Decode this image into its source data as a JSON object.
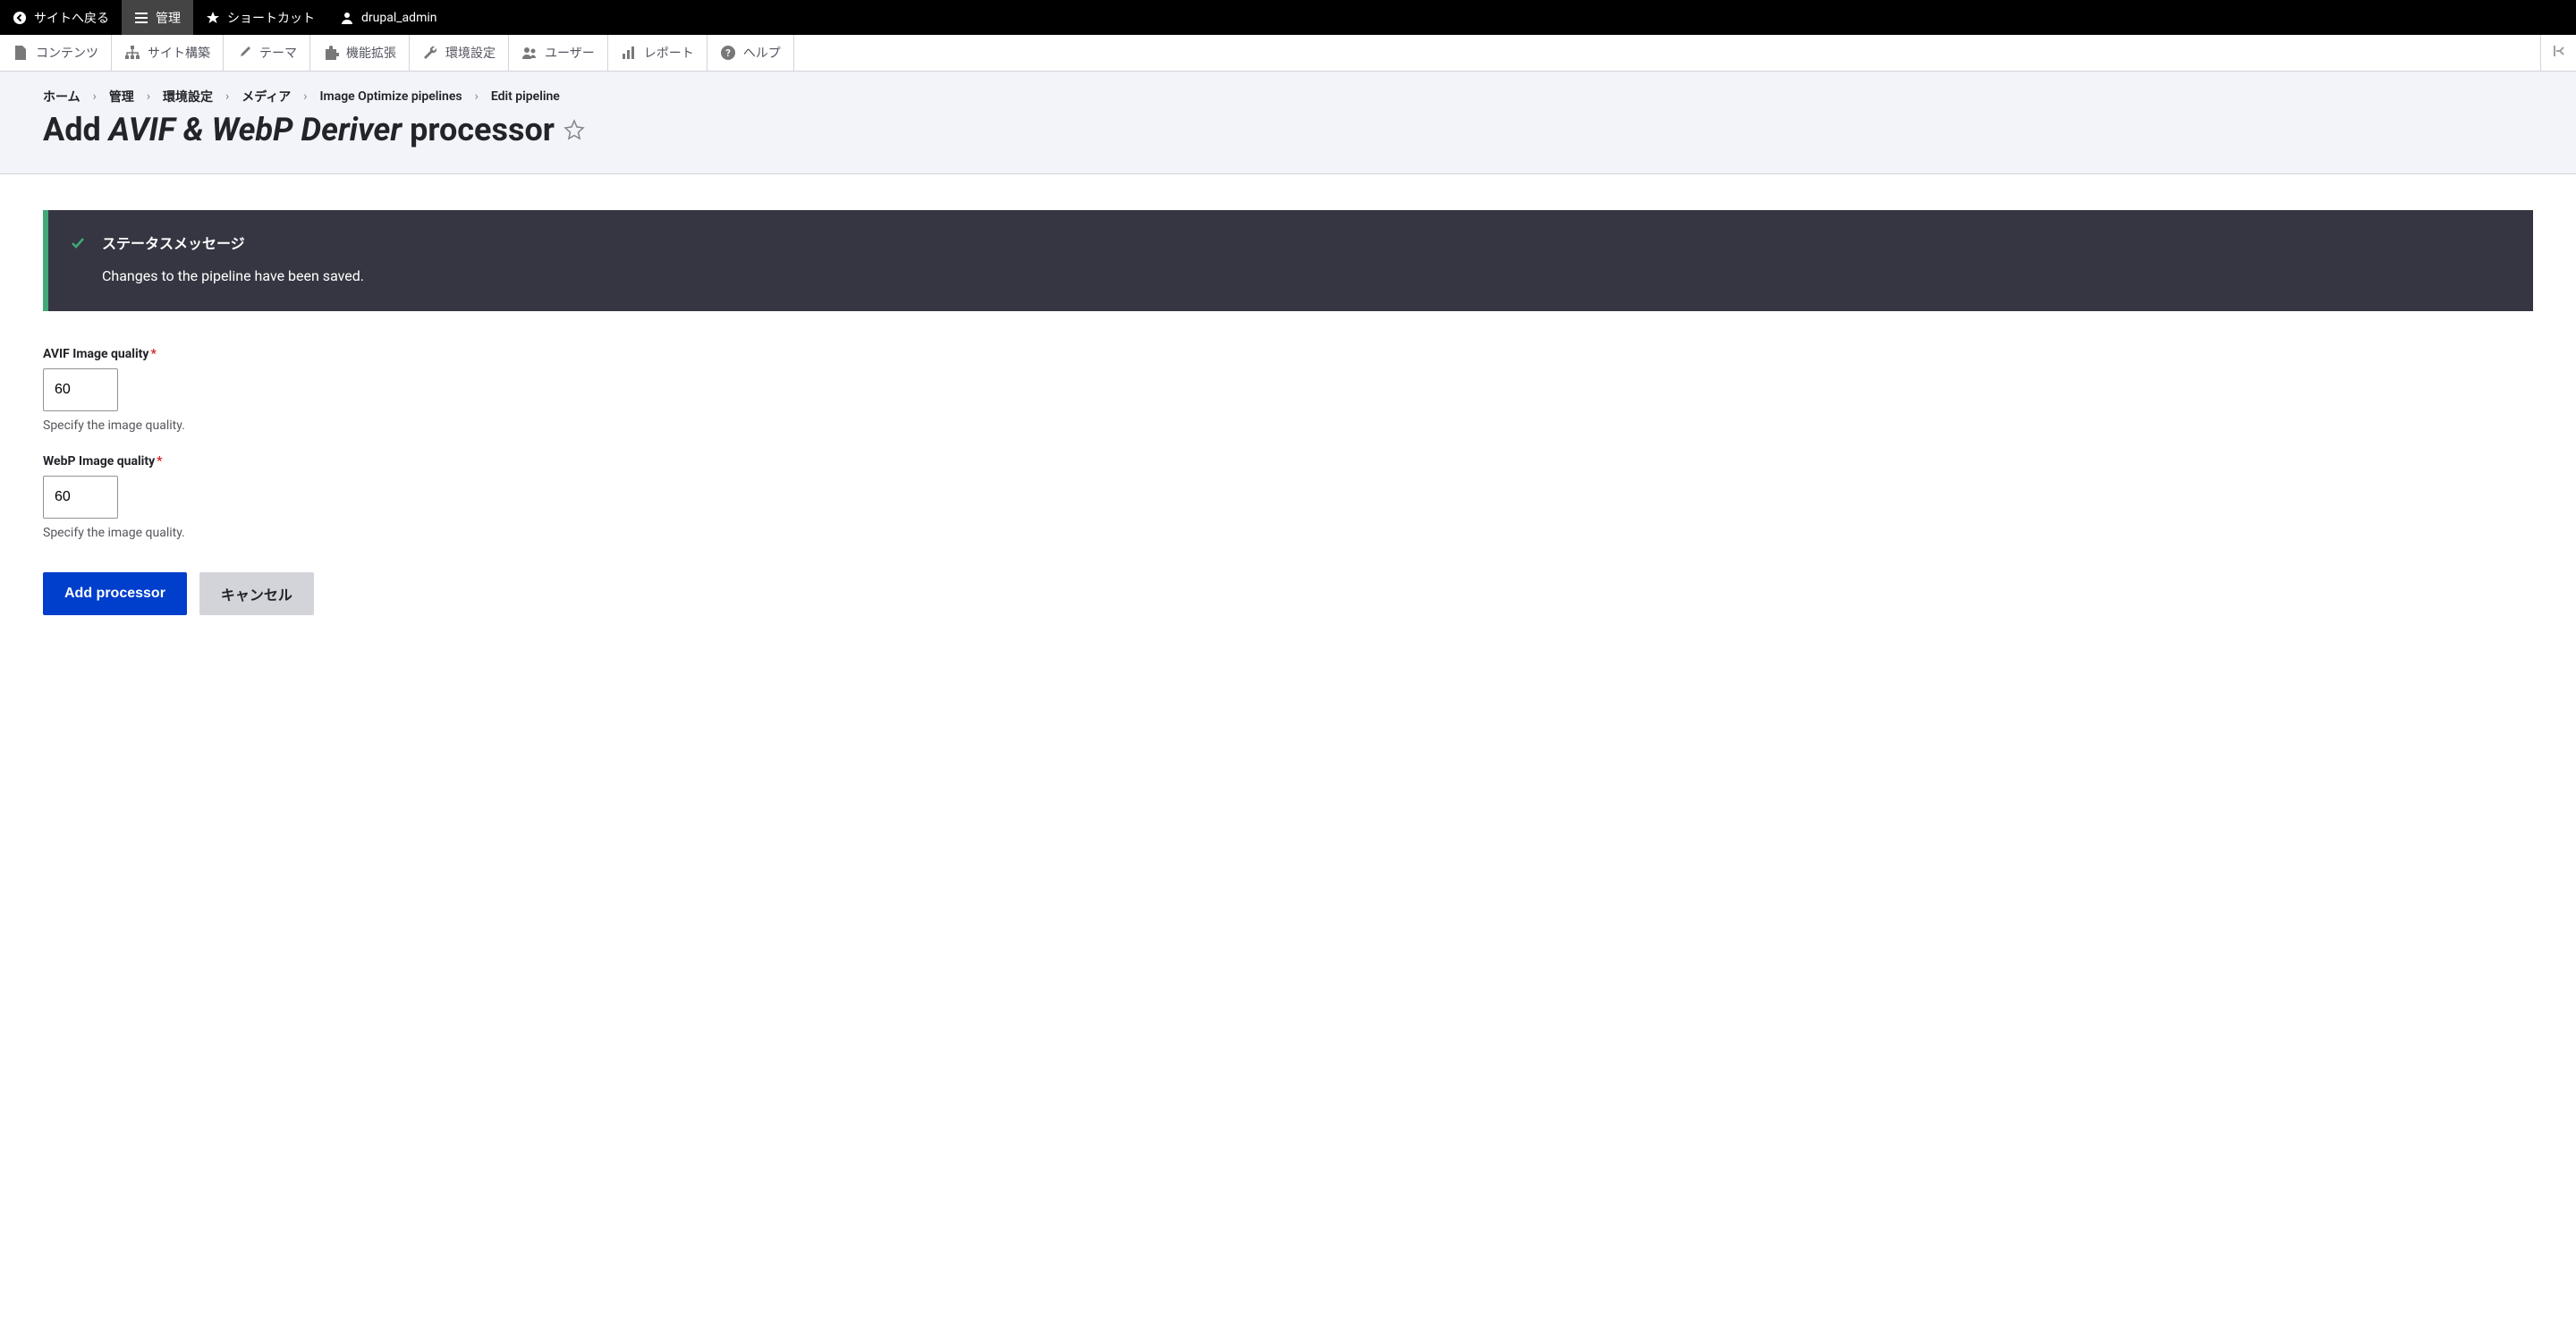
{
  "toolbar": {
    "back_to_site": "サイトへ戻る",
    "manage": "管理",
    "shortcuts": "ショートカット",
    "user": "drupal_admin"
  },
  "admin_menu": {
    "content": "コンテンツ",
    "structure": "サイト構築",
    "appearance": "テーマ",
    "extend": "機能拡張",
    "configuration": "環境設定",
    "people": "ユーザー",
    "reports": "レポート",
    "help": "ヘルプ"
  },
  "breadcrumb": [
    "ホーム",
    "管理",
    "環境設定",
    "メディア",
    "Image Optimize pipelines",
    "Edit pipeline"
  ],
  "page_title_prefix": "Add ",
  "page_title_em": "AVIF & WebP Deriver",
  "page_title_suffix": " processor",
  "status": {
    "title": "ステータスメッセージ",
    "body": "Changes to the pipeline have been saved."
  },
  "form": {
    "avif_label": "AVIF Image quality",
    "avif_value": "60",
    "avif_desc": "Specify the image quality.",
    "webp_label": "WebP Image quality",
    "webp_value": "60",
    "webp_desc": "Specify the image quality.",
    "submit": "Add processor",
    "cancel": "キャンセル"
  }
}
